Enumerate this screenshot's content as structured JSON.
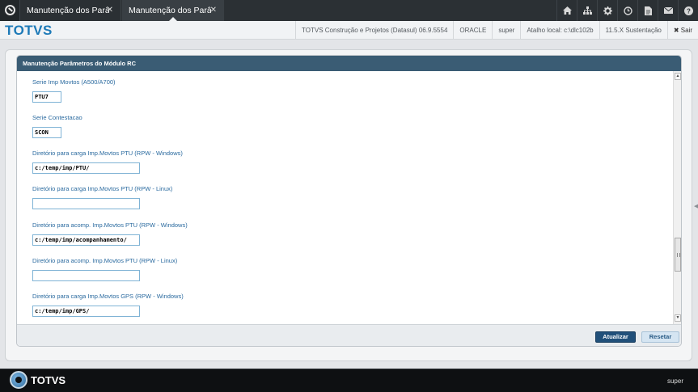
{
  "tabs": [
    {
      "label": "Manutenção dos Parâmetros",
      "close": "✕"
    },
    {
      "label": "Manutenção dos Parâmetros",
      "close": "✕"
    }
  ],
  "toolbar_icons": [
    "home-icon",
    "sitemap-icon",
    "gear-icon",
    "clock-icon",
    "document-icon",
    "mail-icon",
    "help-icon"
  ],
  "header": {
    "brand": "TOTVS",
    "company": "TOTVS Construção e Projetos (Datasul) 06.9.5554",
    "database": "ORACLE",
    "user": "super",
    "shortcut": "Atalho local: c:\\dlc102b",
    "version": "11.5.X Sustentação",
    "exit_label": "✖ Sair"
  },
  "panel": {
    "title": "Manutenção Parâmetros do Módulo RC",
    "fields": [
      {
        "label": "Serie Imp Movtos (A500/A700)",
        "value": "PTU7"
      },
      {
        "label": "Serie Contestacao",
        "value": "SCON"
      },
      {
        "label": "Diretório para carga Imp.Movtos PTU (RPW - Windows)",
        "value": "c:/temp/imp/PTU/"
      },
      {
        "label": "Diretório para carga Imp.Movtos PTU (RPW - Linux)",
        "value": ""
      },
      {
        "label": "Diretório para acomp. Imp.Movtos PTU (RPW - Windows)",
        "value": "c:/temp/imp/acompanhamento/"
      },
      {
        "label": "Diretório para acomp. Imp.Movtos PTU (RPW - Linux)",
        "value": ""
      },
      {
        "label": "Diretório para carga Imp.Movtos GPS (RPW - Windows)",
        "value": "c:/temp/imp/GPS/"
      }
    ],
    "scroll_position": 0.72
  },
  "actions": {
    "primary": "Atualizar",
    "secondary": "Resetar"
  },
  "bottom": {
    "brand": "TOTVS",
    "user": "super"
  },
  "colors": {
    "accent": "#1d7ab8",
    "title_bar": "#3a5c74",
    "primary_button": "#21507a",
    "label": "#2a6a9f"
  }
}
